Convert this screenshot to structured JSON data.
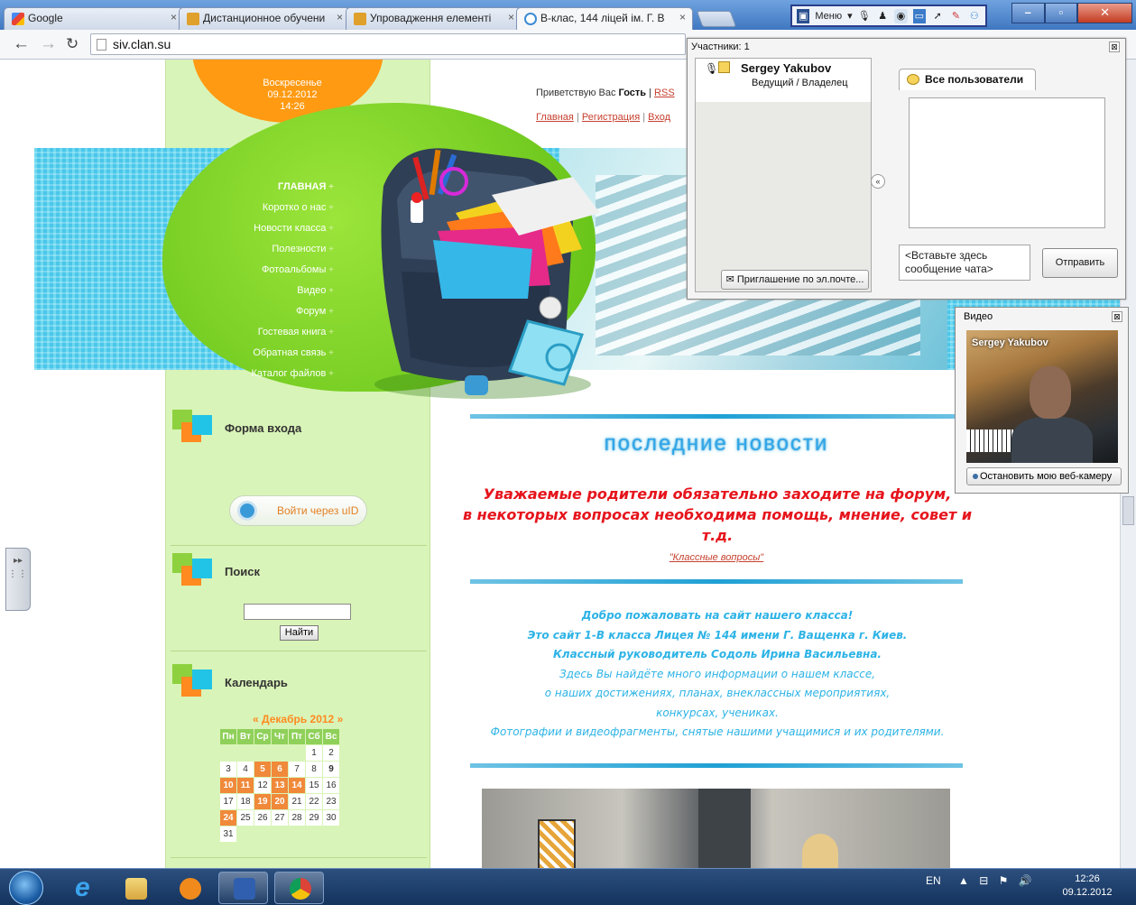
{
  "browser": {
    "tabs": [
      {
        "title": "Google"
      },
      {
        "title": "Дистанционное обучени"
      },
      {
        "title": "Упровадження елементі"
      },
      {
        "title": "В-клас, 144 ліцей ім. Г. В"
      }
    ],
    "url": "siv.clan.su",
    "webinar_menu": "Меню"
  },
  "site": {
    "date": {
      "day": "Воскресенье",
      "date": "09.12.2012",
      "time": "14:26"
    },
    "greeting_prefix": "Приветствую Вас",
    "greeting_user": "Гость",
    "rss": "RSS",
    "top_links": [
      "Главная",
      "Регистрация",
      "Вход"
    ],
    "menu": [
      "Главная",
      "Коротко о нас",
      "Новости класса",
      "Полезности",
      "Фотоальбомы",
      "Видео",
      "Форум",
      "Гостевая книга",
      "Обратная связь",
      "Каталог файлов"
    ],
    "login_block": {
      "title": "Форма входа",
      "uid_button": "Войти через uID"
    },
    "search_block": {
      "title": "Поиск",
      "button": "Найти"
    },
    "calendar_block": {
      "title": "Календарь",
      "month": "Декабрь 2012",
      "prev": "«",
      "next": "»",
      "weekdays": [
        "Пн",
        "Вт",
        "Ср",
        "Чт",
        "Пт",
        "Сб",
        "Вс"
      ],
      "weeks": [
        [
          "",
          "",
          "",
          "",
          "",
          "1",
          "2"
        ],
        [
          "3",
          "4",
          "5",
          "6",
          "7",
          "8",
          "9"
        ],
        [
          "10",
          "11",
          "12",
          "13",
          "14",
          "15",
          "16"
        ],
        [
          "17",
          "18",
          "19",
          "20",
          "21",
          "22",
          "23"
        ],
        [
          "24",
          "25",
          "26",
          "27",
          "28",
          "29",
          "30"
        ],
        [
          "31",
          "",
          "",
          "",
          "",
          "",
          ""
        ]
      ],
      "highlighted_days": [
        "5",
        "6",
        "10",
        "11",
        "13",
        "14",
        "19",
        "20",
        "24"
      ],
      "bold_days": [
        "9"
      ]
    },
    "news_title": "последние новости",
    "notice_lines": [
      "Уважаемые родители обязательно заходите на форум,",
      "в некоторых вопросах необходима помощь, мнение, совет и",
      "т.д."
    ],
    "notice_link": "\"Классные вопросы\"",
    "welcome_lines": [
      "Добро пожаловать на сайт нашего класса!",
      "Это сайт 1-В класса Лицея № 144 имени Г. Ващенка г. Киев.",
      "Классный руководитель Содоль Ирина Васильевна.",
      "Здесь Вы найдёте много информации о нашем классе,",
      "о наших достижениях, планах, внеклассных мероприятиях,",
      "конкурсах, учениках.",
      "Фотографии и видеофрагменты, снятые нашими учащимися и их родителями."
    ]
  },
  "participants_panel": {
    "title": "Участники: 1",
    "participant_name": "Sergey Yakubov",
    "participant_role": "Ведущий / Владелец",
    "invite_button": "Приглашение по эл.почте...",
    "chat_tab": "Все пользователи",
    "chat_placeholder_1": "<Вставьте здесь",
    "chat_placeholder_2": "сообщение чата>",
    "send_button": "Отправить"
  },
  "video_panel": {
    "title": "Видео",
    "user_label": "Sergey Yakubov",
    "stop_button": "Остановить мою веб-камеру"
  },
  "taskbar": {
    "lang": "EN",
    "time": "12:26",
    "date": "09.12.2012"
  }
}
